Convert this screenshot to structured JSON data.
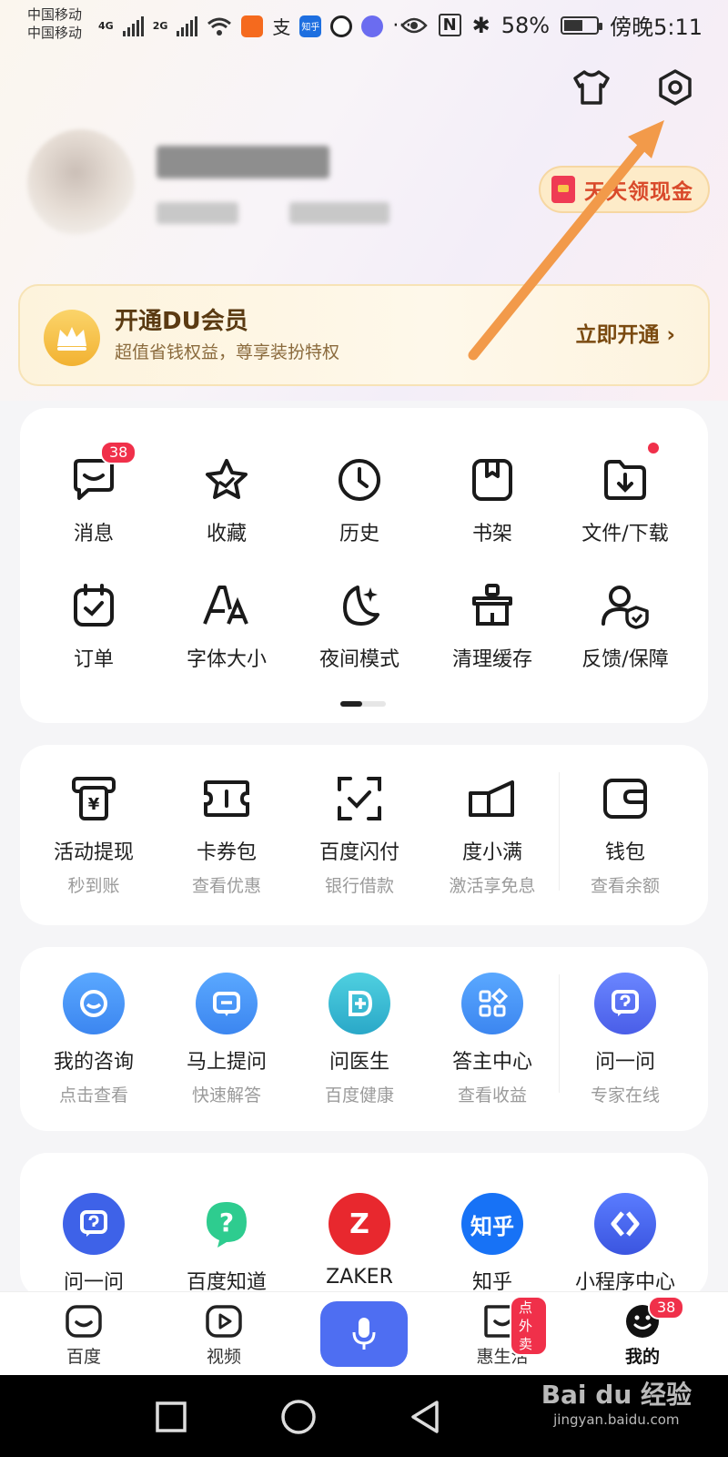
{
  "status": {
    "carrier1": "中国移动",
    "carrier2": "中国移动",
    "net1": "4G",
    "net2": "2G",
    "zhihu_mini": "知乎",
    "more": "···",
    "battery": "58%",
    "time": "傍晚5:11"
  },
  "header": {
    "cash_label": "天天领现金"
  },
  "vip": {
    "title": "开通DU会员",
    "subtitle": "超值省钱权益，尊享装扮特权",
    "cta": "立即开通 ›"
  },
  "quick": {
    "row1": [
      {
        "label": "消息",
        "icon": "message-icon",
        "badge": "38"
      },
      {
        "label": "收藏",
        "icon": "star-icon"
      },
      {
        "label": "历史",
        "icon": "clock-icon"
      },
      {
        "label": "书架",
        "icon": "bookshelf-icon"
      },
      {
        "label": "文件/下载",
        "icon": "download-folder-icon"
      }
    ],
    "row2": [
      {
        "label": "订单",
        "icon": "order-icon"
      },
      {
        "label": "字体大小",
        "icon": "font-size-icon"
      },
      {
        "label": "夜间模式",
        "icon": "moon-icon"
      },
      {
        "label": "清理缓存",
        "icon": "clean-icon"
      },
      {
        "label": "反馈/保障",
        "icon": "feedback-shield-icon"
      }
    ]
  },
  "finance": [
    {
      "label": "活动提现",
      "sub": "秒到账"
    },
    {
      "label": "卡券包",
      "sub": "查看优惠"
    },
    {
      "label": "百度闪付",
      "sub": "银行借款"
    },
    {
      "label": "度小满",
      "sub": "激活享免息"
    },
    {
      "label": "钱包",
      "sub": "查看余额"
    }
  ],
  "services": [
    {
      "label": "我的咨询",
      "sub": "点击查看"
    },
    {
      "label": "马上提问",
      "sub": "快速解答"
    },
    {
      "label": "问医生",
      "sub": "百度健康"
    },
    {
      "label": "答主中心",
      "sub": "查看收益"
    },
    {
      "label": "问一问",
      "sub": "专家在线"
    }
  ],
  "apps": [
    {
      "label": "问一问"
    },
    {
      "label": "百度知道"
    },
    {
      "label": "ZAKER",
      "glyph": "Z"
    },
    {
      "label": "知乎",
      "glyph": "知乎"
    },
    {
      "label": "小程序中心"
    }
  ],
  "bottom_nav": [
    {
      "label": "百度"
    },
    {
      "label": "视频"
    },
    {
      "label": ""
    },
    {
      "label": "惠生活",
      "badge": "点外卖"
    },
    {
      "label": "我的",
      "badge": "38"
    }
  ],
  "watermark": {
    "main": "Bai du 经验",
    "url": "jingyan.baidu.com"
  },
  "colors": {
    "accent": "#4e6ef2",
    "badge": "#f0304a",
    "vip_gold": "#f2b232",
    "arrow": "#f29a4a"
  }
}
